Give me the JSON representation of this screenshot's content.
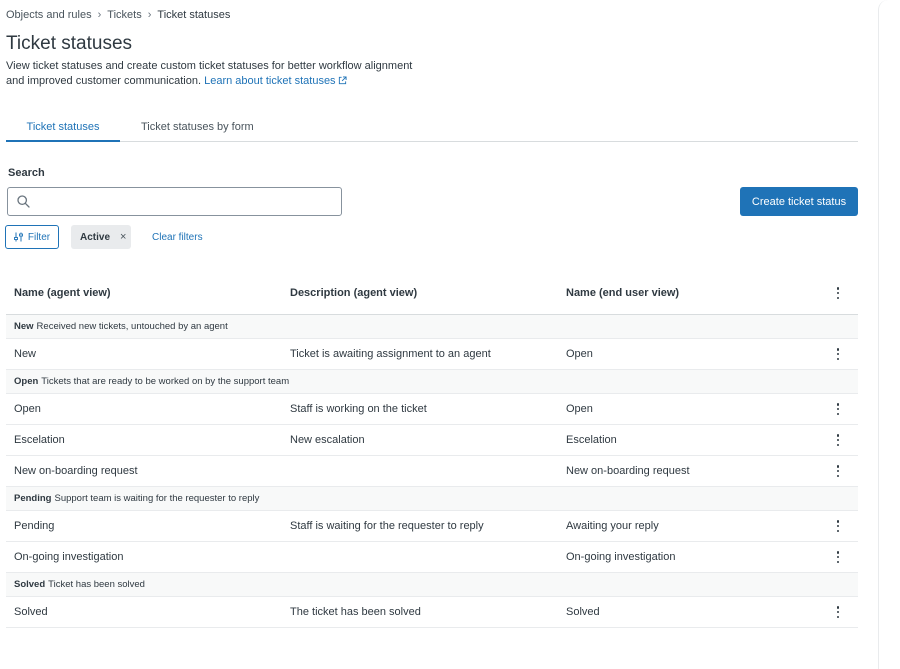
{
  "breadcrumb": [
    "Objects and rules",
    "Tickets",
    "Ticket statuses"
  ],
  "page": {
    "title": "Ticket statuses",
    "description": "View ticket statuses and create custom ticket statuses for better workflow alignment and improved customer communication.",
    "learn_link": "Learn about ticket statuses"
  },
  "tabs": [
    "Ticket statuses",
    "Ticket statuses by form"
  ],
  "search": {
    "label": "Search",
    "value": "",
    "placeholder": ""
  },
  "create_button": "Create ticket status",
  "filters": {
    "filter_label": "Filter",
    "active_tag": "Active",
    "remove_tag": "×",
    "clear_label": "Clear filters"
  },
  "table": {
    "headers": [
      "Name (agent view)",
      "Description (agent view)",
      "Name (end user view)"
    ],
    "groups": [
      {
        "name": "New",
        "description": "Received new tickets, untouched by an agent",
        "rows": [
          {
            "name": "New",
            "desc": "Ticket is awaiting assignment to an agent",
            "end_user": "Open"
          }
        ]
      },
      {
        "name": "Open",
        "description": "Tickets that are ready to be worked on by the support team",
        "rows": [
          {
            "name": "Open",
            "desc": "Staff is working on the ticket",
            "end_user": "Open"
          },
          {
            "name": "Escelation",
            "desc": "New escalation",
            "end_user": "Escelation"
          },
          {
            "name": "New on-boarding request",
            "desc": "",
            "end_user": "New on-boarding request"
          }
        ]
      },
      {
        "name": "Pending",
        "description": "Support team is waiting for the requester to reply",
        "rows": [
          {
            "name": "Pending",
            "desc": "Staff is waiting for the requester to reply",
            "end_user": "Awaiting your reply"
          },
          {
            "name": "On-going investigation",
            "desc": "",
            "end_user": "On-going investigation"
          }
        ]
      },
      {
        "name": "Solved",
        "description": "Ticket has been solved",
        "rows": [
          {
            "name": "Solved",
            "desc": "The ticket has been solved",
            "end_user": "Solved"
          }
        ]
      }
    ]
  },
  "colors": {
    "accent": "#1f73b7",
    "text": "#2f3941",
    "border": "#d8dcde"
  }
}
